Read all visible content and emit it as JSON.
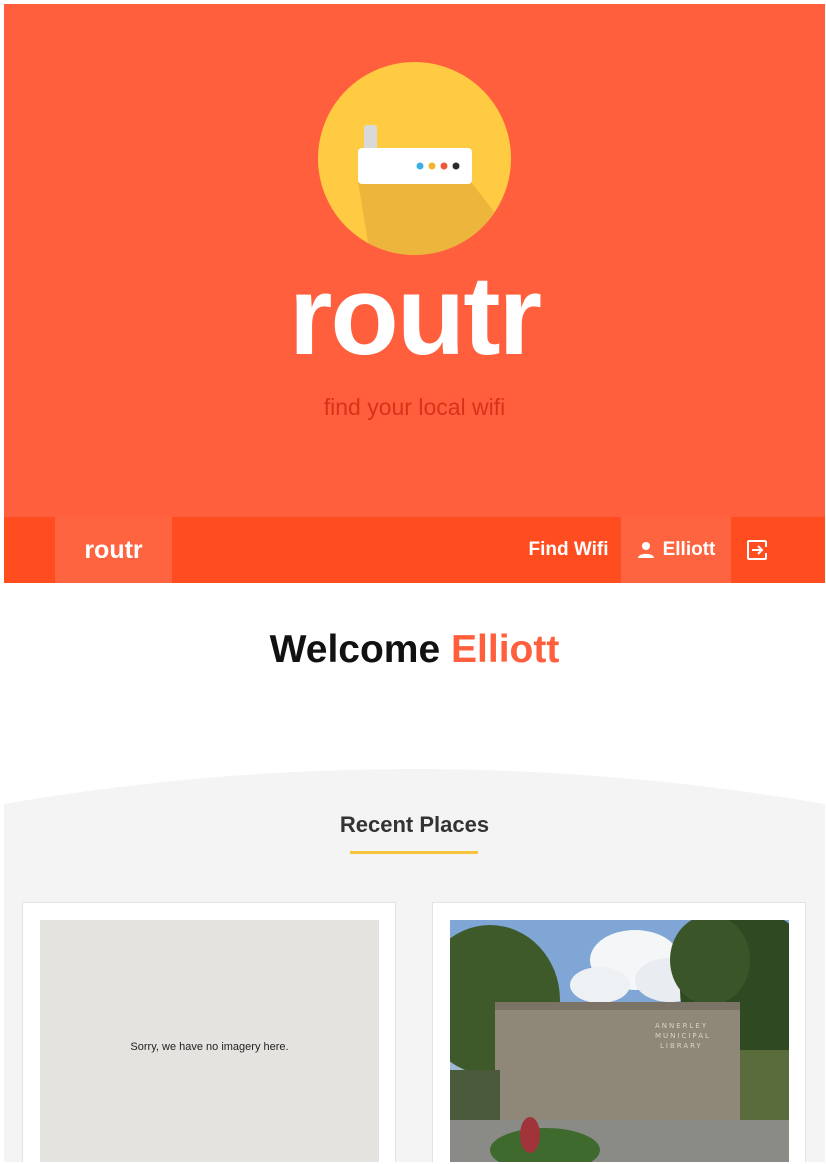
{
  "hero": {
    "brand": "routr",
    "tagline": "find your local wifi"
  },
  "navbar": {
    "brand": "routr",
    "find_wifi": "Find Wifi",
    "user_name": "Elliott"
  },
  "welcome": {
    "prefix": "Welcome",
    "name": "Elliott"
  },
  "recent": {
    "heading": "Recent Places",
    "places": [
      {
        "image_message": "Sorry, we have no imagery here."
      },
      {
        "image_alt": "Street view of library building"
      }
    ]
  },
  "colors": {
    "brand_orange": "#ff5f3c",
    "nav_orange": "#ff4d20",
    "logo_yellow": "#ffcb42",
    "underline_yellow": "#f6c33a",
    "section_gray": "#f4f4f4"
  }
}
